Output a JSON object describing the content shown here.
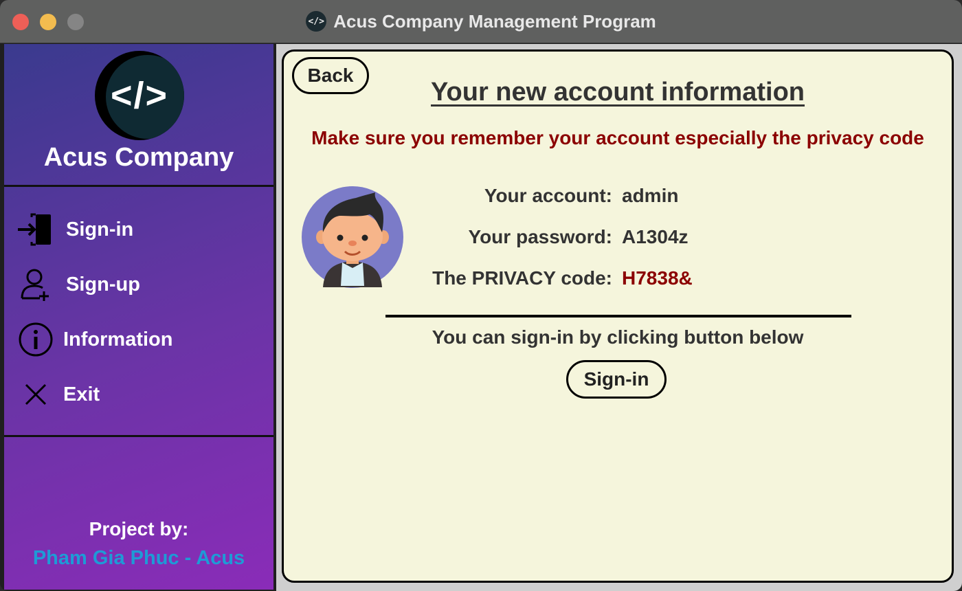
{
  "window": {
    "title": "Acus Company Management Program",
    "icon_text": "</>"
  },
  "sidebar": {
    "logo_text": "</>",
    "company_name": "Acus Company",
    "items": [
      {
        "label": "Sign-in",
        "icon": "sign-in-door-icon"
      },
      {
        "label": "Sign-up",
        "icon": "add-user-icon"
      },
      {
        "label": "Information",
        "icon": "info-circle-icon"
      },
      {
        "label": "Exit",
        "icon": "close-x-icon"
      }
    ],
    "credit_title": "Project by:",
    "credit_author": "Pham Gia Phuc - Acus"
  },
  "main": {
    "back_label": "Back",
    "title": "Your new account information",
    "warning": "Make sure you remember your account especially the privacy code",
    "fields": [
      {
        "label": "Your account:",
        "value": "admin"
      },
      {
        "label": "Your password:",
        "value": "A1304z"
      },
      {
        "label": "The PRIVACY code:",
        "value": "H7838&"
      }
    ],
    "hint": "You can sign-in by clicking button below",
    "signin_label": "Sign-in"
  },
  "colors": {
    "sidebar_gradient_start": "#3a3a8e",
    "sidebar_gradient_end": "#8a2cb8",
    "card_background": "#f5f5dc",
    "warning": "#8b0000",
    "author": "#1e9bd6"
  }
}
